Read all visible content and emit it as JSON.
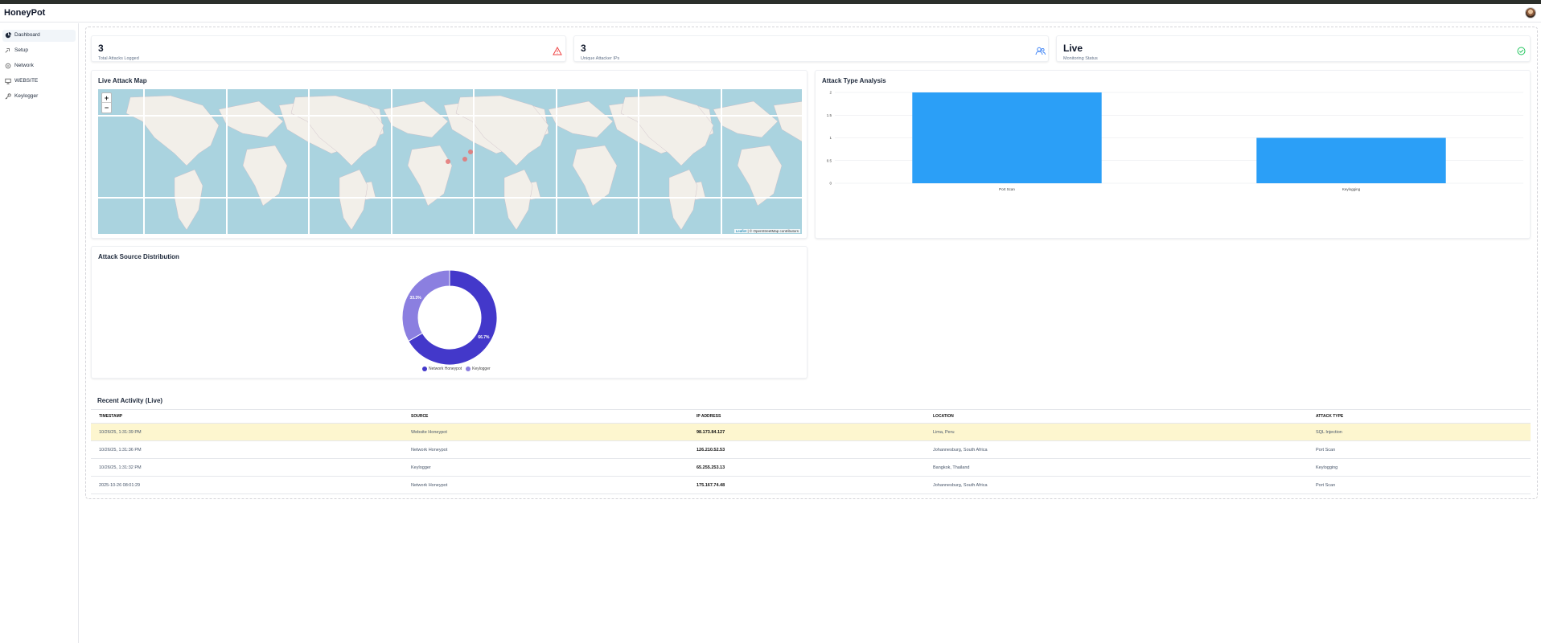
{
  "app": {
    "title": "HoneyPot"
  },
  "sidebar": {
    "items": [
      {
        "label": "Dashboard",
        "icon": "dashboard-icon",
        "active": true
      },
      {
        "label": "Setup",
        "icon": "setup-icon"
      },
      {
        "label": "Network",
        "icon": "network-icon"
      },
      {
        "label": "WEBSITE",
        "icon": "monitor-icon"
      },
      {
        "label": "Keylogger",
        "icon": "key-icon"
      }
    ]
  },
  "stats": [
    {
      "value": "3",
      "label": "Total Attacks Logged",
      "icon": "alert-triangle-icon",
      "color": "#ef4444"
    },
    {
      "value": "3",
      "label": "Unique Attacker IPs",
      "icon": "users-icon",
      "color": "#3b82f6"
    },
    {
      "value": "Live",
      "label": "Monitoring Status",
      "icon": "check-circle-icon",
      "color": "#22c55e"
    }
  ],
  "map": {
    "title": "Live Attack Map",
    "zoom_in": "+",
    "zoom_out": "−",
    "attribution_leaflet": "Leaflet",
    "attribution_osm": "| © OpenStreetMap contributors",
    "marker_color": "#e57373",
    "marker_count": 3
  },
  "attack_type": {
    "title": "Attack Type Analysis",
    "chart_data": {
      "type": "bar",
      "categories": [
        "Port Scan",
        "Keylogging"
      ],
      "values": [
        2,
        1
      ],
      "ylim": [
        0,
        2
      ],
      "yticks": [
        "0",
        "0.5",
        "1",
        "1.5",
        "2"
      ],
      "color": "#2b9ff7"
    }
  },
  "attack_source": {
    "title": "Attack Source Distribution",
    "chart_data": {
      "type": "pie",
      "categories": [
        "Network Honeypot",
        "Keylogger"
      ],
      "values": [
        66.7,
        33.3
      ],
      "labels": [
        "66.7%",
        "33.3%"
      ],
      "colors": [
        "#4338ca",
        "#8b7fe0"
      ]
    }
  },
  "activity": {
    "title": "Recent Activity (Live)",
    "columns": [
      "TIMESTAMP",
      "SOURCE",
      "IP ADDRESS",
      "LOCATION",
      "ATTACK TYPE"
    ],
    "rows": [
      [
        "10/26/25, 1:31:39 PM",
        "Website Honeypot",
        "98.173.84.127",
        "Lima, Peru",
        "SQL Injection"
      ],
      [
        "10/26/25, 1:31:36 PM",
        "Network Honeypot",
        "126.210.52.53",
        "Johannesburg, South Africa",
        "Port Scan"
      ],
      [
        "10/26/25, 1:31:32 PM",
        "Keylogger",
        "65.255.253.13",
        "Bangkok, Thailand",
        "Keylogging"
      ],
      [
        "2025-10-26 08:01:29",
        "Network Honeypot",
        "175.167.74.48",
        "Johannesburg, South Africa",
        "Port Scan"
      ]
    ]
  }
}
